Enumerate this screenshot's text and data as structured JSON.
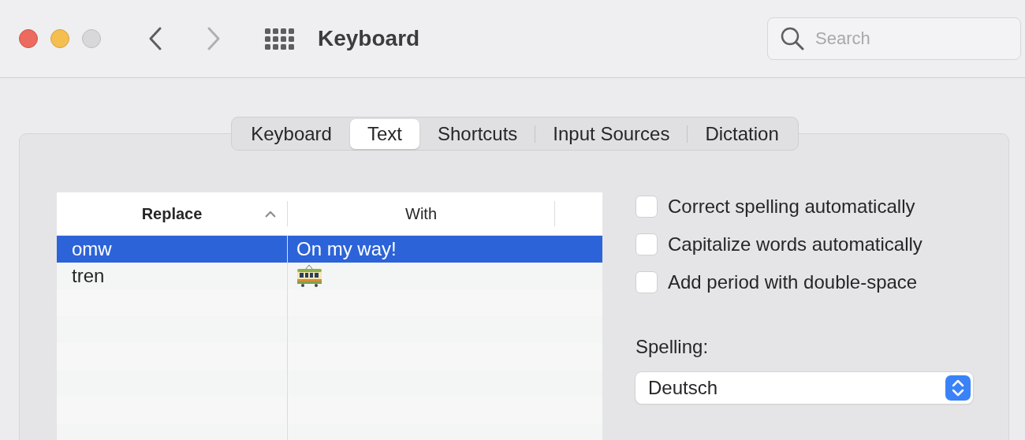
{
  "window": {
    "title": "Keyboard"
  },
  "search": {
    "placeholder": "Search"
  },
  "tabs": [
    {
      "label": "Keyboard",
      "selected": false
    },
    {
      "label": "Text",
      "selected": true
    },
    {
      "label": "Shortcuts",
      "selected": false
    },
    {
      "label": "Input Sources",
      "selected": false
    },
    {
      "label": "Dictation",
      "selected": false
    }
  ],
  "table": {
    "columns": [
      {
        "label": "Replace",
        "sorted": true
      },
      {
        "label": "With",
        "sorted": false
      }
    ],
    "rows": [
      {
        "replace": "omw",
        "kind": "text",
        "with": "On my way!",
        "selected": true
      },
      {
        "replace": "tren",
        "kind": "tram-icon",
        "selected": false
      }
    ]
  },
  "options": [
    {
      "label": "Correct spelling automatically",
      "checked": false
    },
    {
      "label": "Capitalize words automatically",
      "checked": false
    },
    {
      "label": "Add period with double-space",
      "checked": false
    }
  ],
  "spelling": {
    "label": "Spelling:",
    "value": "Deutsch"
  }
}
